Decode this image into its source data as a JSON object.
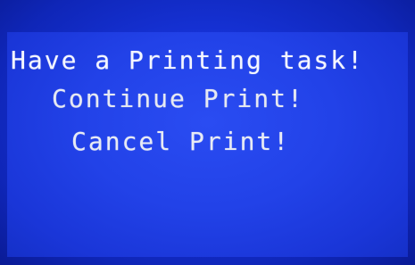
{
  "screen": {
    "message": "Have a Printing task!",
    "options": [
      {
        "label": "Continue Print!"
      },
      {
        "label": "Cancel Print!"
      }
    ]
  },
  "colors": {
    "background": "#1f3fe6",
    "text": "#f4f6ff"
  }
}
